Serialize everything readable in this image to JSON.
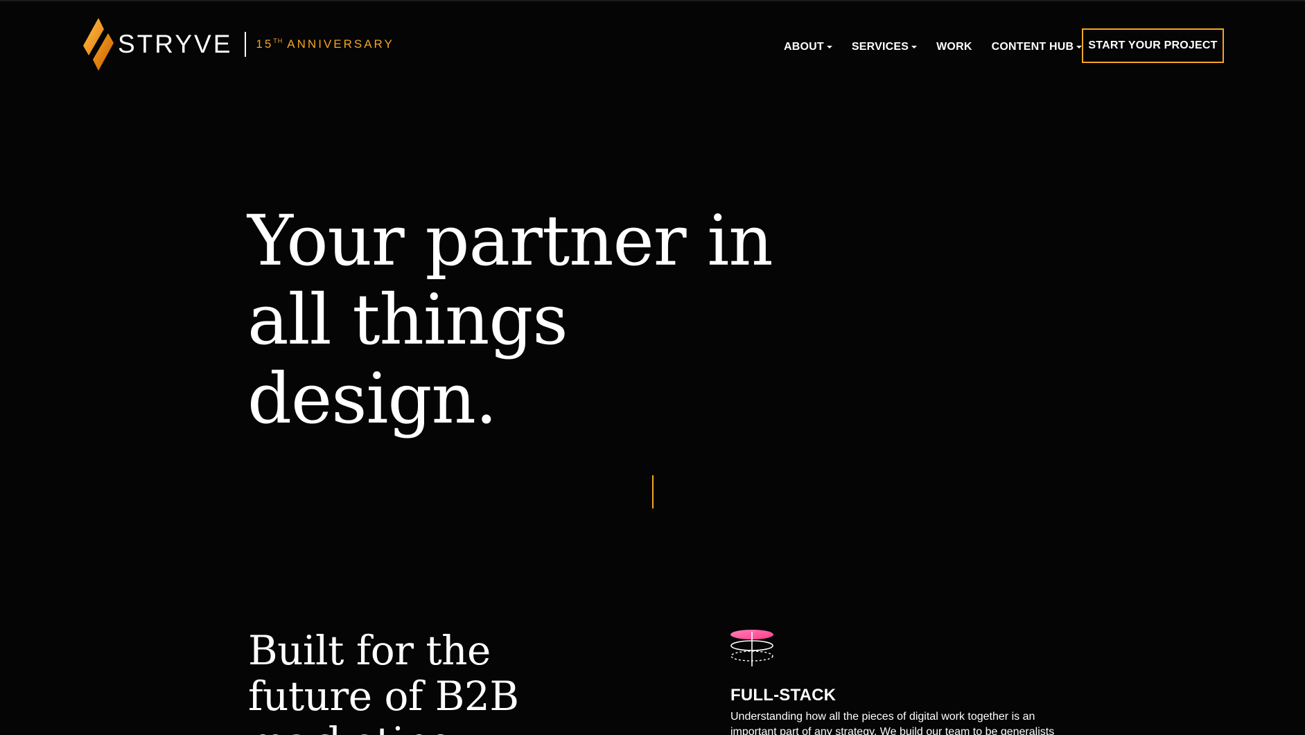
{
  "brand": {
    "name": "STRYVE",
    "anniversary_number": "15",
    "anniversary_suffix": "TH",
    "anniversary_text": "ANNIVERSARY",
    "logo_icon": "stryve-diamond-logo-icon",
    "accent_color": "#f5a623"
  },
  "nav": {
    "items": [
      {
        "label": "ABOUT",
        "has_dropdown": true
      },
      {
        "label": "SERVICES",
        "has_dropdown": true
      },
      {
        "label": "WORK",
        "has_dropdown": false
      },
      {
        "label": "CONTENT HUB",
        "has_dropdown": true
      }
    ],
    "dropdown_icon": "caret-down-icon",
    "cta_label": "START YOUR PROJECT"
  },
  "hero": {
    "title_lines": [
      "Your partner in",
      "all things",
      "design."
    ],
    "scroll_indicator": "orange-vertical-line"
  },
  "section": {
    "title_lines": [
      "Built for the",
      "future of B2B",
      "marketing."
    ],
    "feature": {
      "icon": "full-stack-layers-icon",
      "title": "FULL-STACK",
      "text": "Understanding how all the pieces of digital work together is an important part of any strategy. We build our team to be generalists"
    }
  },
  "colors": {
    "background": "#050505",
    "text": "#ffffff",
    "accent": "#f5a623",
    "icon_pink": "#ff5fa2"
  }
}
